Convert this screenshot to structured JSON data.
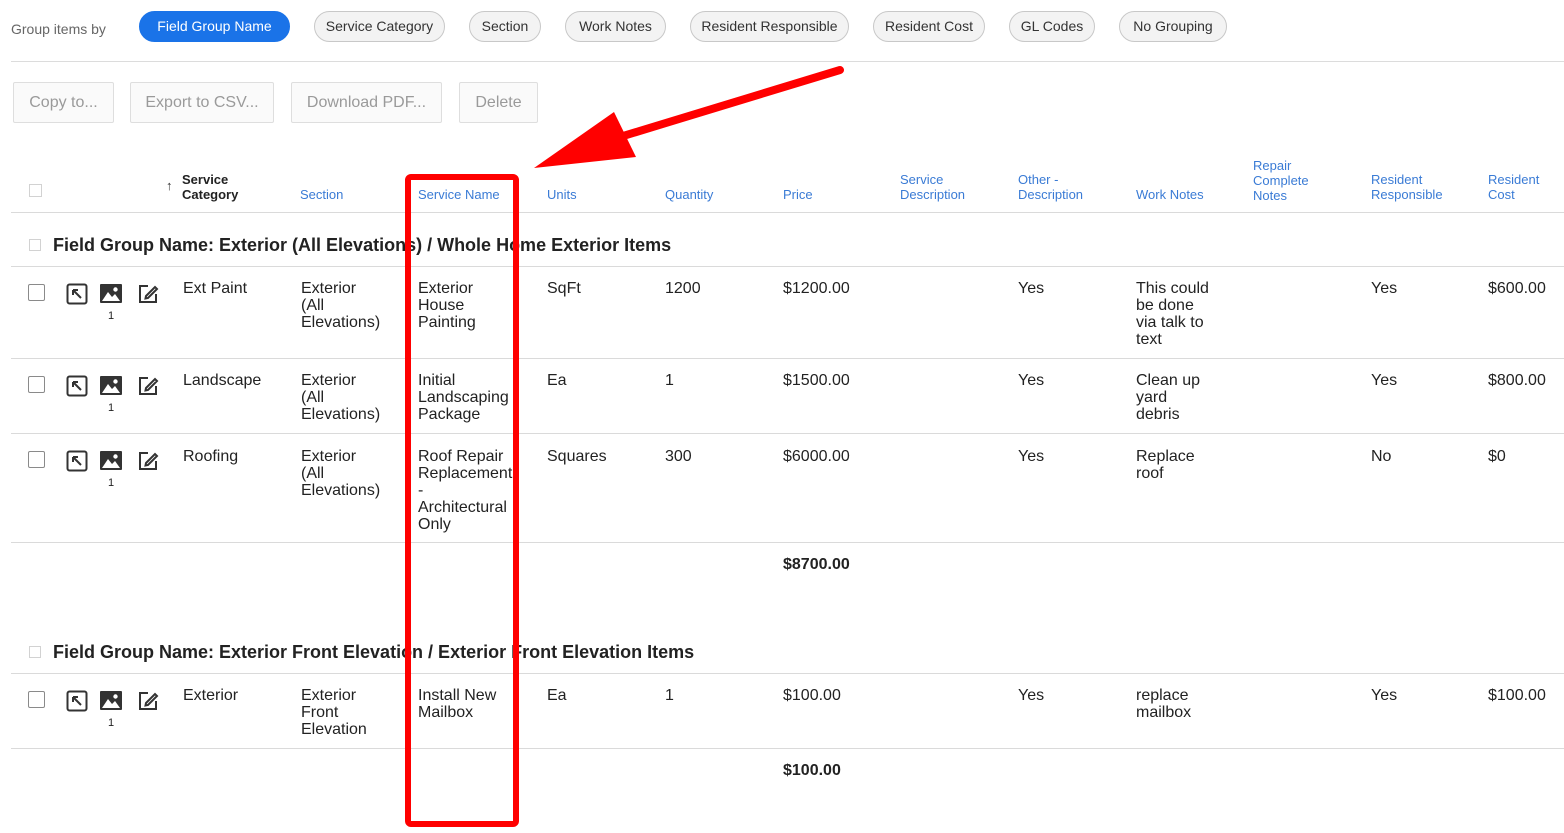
{
  "group_by": {
    "label": "Group items by",
    "options": [
      {
        "label": "Field Group Name",
        "active": true
      },
      {
        "label": "Service Category",
        "active": false
      },
      {
        "label": "Section",
        "active": false
      },
      {
        "label": "Work Notes",
        "active": false
      },
      {
        "label": "Resident Responsible",
        "active": false
      },
      {
        "label": "Resident Cost",
        "active": false
      },
      {
        "label": "GL Codes",
        "active": false
      },
      {
        "label": "No Grouping",
        "active": false
      }
    ]
  },
  "actions": {
    "copy": "Copy to...",
    "export_csv": "Export to CSV...",
    "download_pdf": "Download PDF...",
    "delete": "Delete"
  },
  "columns": {
    "service_category": [
      "Service",
      "Category"
    ],
    "section": "Section",
    "service_name": "Service Name",
    "units": "Units",
    "quantity": "Quantity",
    "price": "Price",
    "service_description": [
      "Service",
      "Description"
    ],
    "other_description": [
      "Other -",
      "Description"
    ],
    "work_notes": "Work Notes",
    "repair_complete_notes": [
      "Repair",
      "Complete",
      "Notes"
    ],
    "resident_responsible": [
      "Resident",
      "Responsible"
    ],
    "resident_cost": [
      "Resident",
      "Cost"
    ]
  },
  "groups": [
    {
      "title": "Field Group Name: Exterior (All Elevations) / Whole Home Exterior Items",
      "total": "$8700.00",
      "rows": [
        {
          "image_count": "1",
          "service_category": "Ext Paint",
          "section": [
            "Exterior",
            "(All",
            "Elevations)"
          ],
          "service_name": [
            "Exterior",
            "House",
            "Painting"
          ],
          "units": "SqFt",
          "quantity": "1200",
          "price": "$1200.00",
          "other_description": "Yes",
          "work_notes": [
            "This could",
            "be done",
            "via talk to",
            "text"
          ],
          "resident_responsible": "Yes",
          "resident_cost": "$600.00"
        },
        {
          "image_count": "1",
          "service_category": "Landscape",
          "section": [
            "Exterior",
            "(All",
            "Elevations)"
          ],
          "service_name": [
            "Initial",
            "Landscaping",
            "Package"
          ],
          "units": "Ea",
          "quantity": "1",
          "price": "$1500.00",
          "other_description": "Yes",
          "work_notes": [
            "Clean up",
            "yard",
            "debris"
          ],
          "resident_responsible": "Yes",
          "resident_cost": "$800.00"
        },
        {
          "image_count": "1",
          "service_category": "Roofing",
          "section": [
            "Exterior",
            "(All",
            "Elevations)"
          ],
          "service_name": [
            "Roof Repair",
            "Replacement",
            "-",
            "Architectural",
            "Only"
          ],
          "units": "Squares",
          "quantity": "300",
          "price": "$6000.00",
          "other_description": "Yes",
          "work_notes": [
            "Replace",
            "roof"
          ],
          "resident_responsible": "No",
          "resident_cost": "$0"
        }
      ]
    },
    {
      "title": "Field Group Name: Exterior Front Elevation / Exterior Front Elevation Items",
      "total": "$100.00",
      "rows": [
        {
          "image_count": "1",
          "service_category": "Exterior",
          "section": [
            "Exterior",
            "Front",
            "Elevation"
          ],
          "service_name": [
            "Install New",
            "Mailbox"
          ],
          "units": "Ea",
          "quantity": "1",
          "price": "$100.00",
          "other_description": "Yes",
          "work_notes": [
            "replace",
            "mailbox"
          ],
          "resident_responsible": "Yes",
          "resident_cost": "$100.00"
        }
      ]
    }
  ],
  "colors": {
    "accent": "#1a73e8",
    "header_link": "#3a7bd5",
    "annotation": "#ff0000"
  },
  "icons": [
    "expand-icon",
    "image-icon",
    "edit-icon",
    "sort-up-icon"
  ]
}
